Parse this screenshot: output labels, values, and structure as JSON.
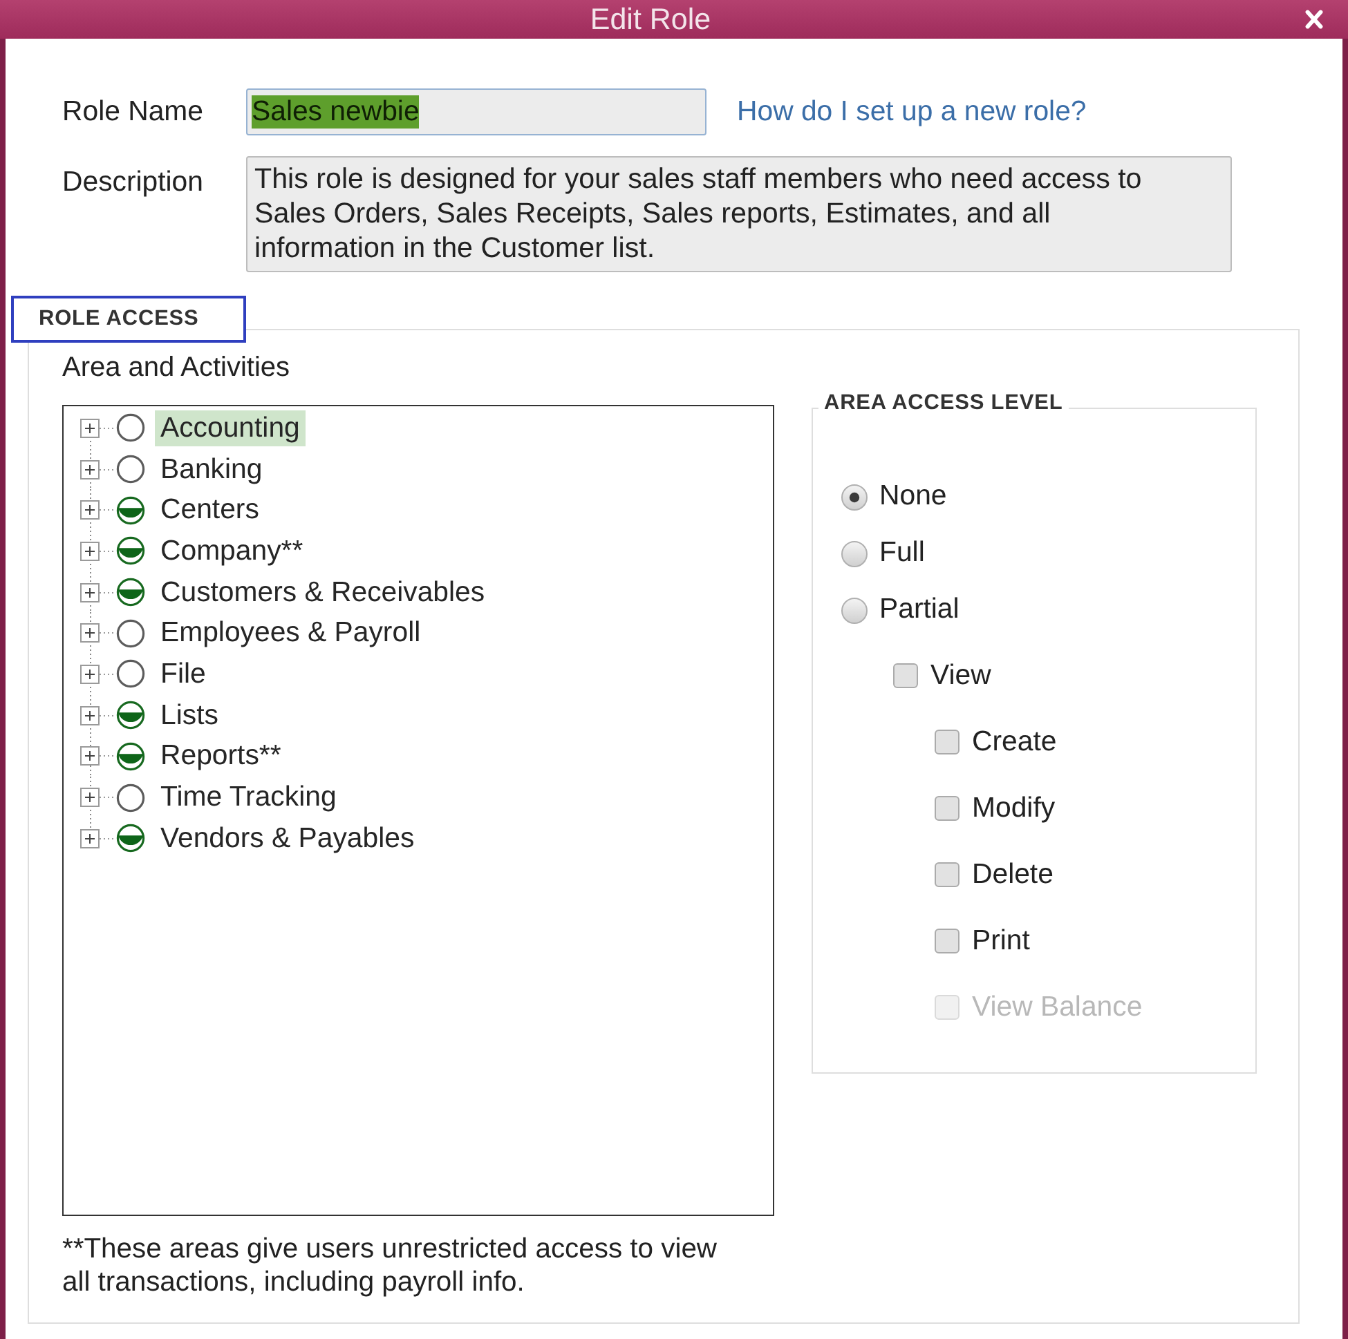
{
  "window": {
    "title": "Edit Role"
  },
  "role_name": {
    "label": "Role Name",
    "value": "Sales newbie",
    "value_selected": true
  },
  "help_link": "How do I set up a new role?",
  "description": {
    "label": "Description",
    "value": "This role is designed for your sales staff members who need access to Sales Orders, Sales Receipts, Sales reports, Estimates, and all information in the Customer list."
  },
  "role_access": {
    "title": "ROLE ACCESS",
    "highlighted": true,
    "tree_label": "Area and Activities",
    "areas": [
      {
        "label": "Accounting",
        "kind": "none",
        "expanded": false,
        "selected": true
      },
      {
        "label": "Banking",
        "kind": "none",
        "expanded": false,
        "selected": false
      },
      {
        "label": "Centers",
        "kind": "partial",
        "expanded": false,
        "selected": false
      },
      {
        "label": "Company**",
        "kind": "partial",
        "expanded": false,
        "selected": false
      },
      {
        "label": "Customers & Receivables",
        "kind": "partial",
        "expanded": false,
        "selected": false
      },
      {
        "label": "Employees & Payroll",
        "kind": "none",
        "expanded": false,
        "selected": false
      },
      {
        "label": "File",
        "kind": "none",
        "expanded": false,
        "selected": false
      },
      {
        "label": "Lists",
        "kind": "partial",
        "expanded": false,
        "selected": false
      },
      {
        "label": "Reports**",
        "kind": "partial",
        "expanded": false,
        "selected": false
      },
      {
        "label": "Time Tracking",
        "kind": "none",
        "expanded": false,
        "selected": false
      },
      {
        "label": "Vendors & Payables",
        "kind": "partial",
        "expanded": false,
        "selected": false
      }
    ],
    "footnote": "**These areas give users unrestricted access to view all transactions, including payroll info."
  },
  "area_access_level": {
    "title": "AREA ACCESS LEVEL",
    "options": [
      {
        "label": "None",
        "selected": true
      },
      {
        "label": "Full",
        "selected": false
      },
      {
        "label": "Partial",
        "selected": false
      }
    ],
    "permissions": [
      {
        "label": "View",
        "checked": false,
        "disabled": false,
        "children": [
          {
            "label": "Create",
            "checked": false,
            "disabled": false
          },
          {
            "label": "Modify",
            "checked": false,
            "disabled": false
          },
          {
            "label": "Delete",
            "checked": false,
            "disabled": false
          },
          {
            "label": "Print",
            "checked": false,
            "disabled": false
          },
          {
            "label": "View Balance",
            "checked": false,
            "disabled": true
          }
        ]
      }
    ]
  }
}
